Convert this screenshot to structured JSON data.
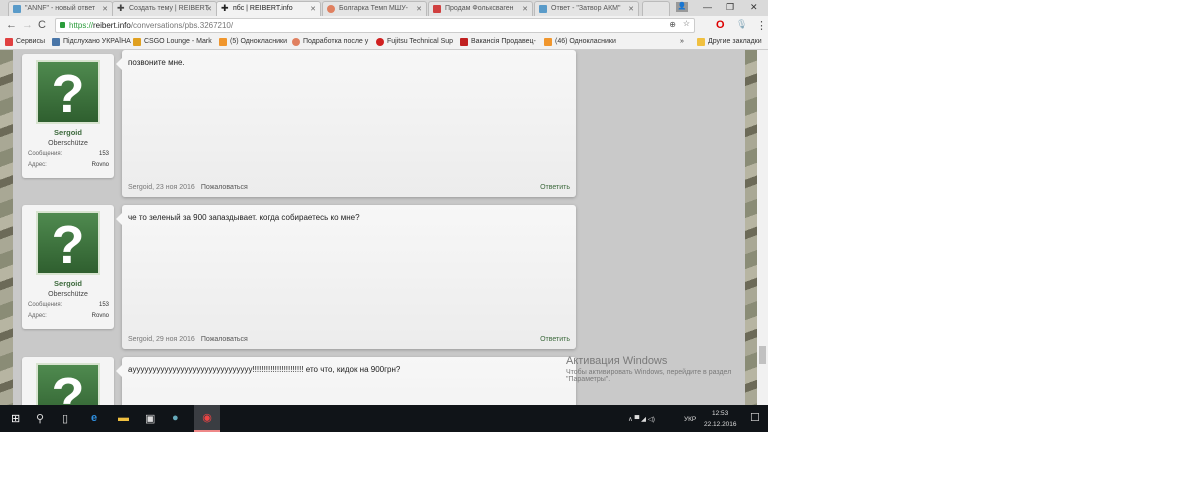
{
  "tabs": [
    {
      "label": "\"ANNF\" - новый ответ",
      "color": "#5a9bc9"
    },
    {
      "label": "Создать тему | REIBERT",
      "color": "#444"
    },
    {
      "label": "пбс | REIBERT.info",
      "color": "#444",
      "active": true
    },
    {
      "label": "Болгарка Темп МШУ-",
      "color": "#e08060"
    },
    {
      "label": "Продам Фольксваген",
      "color": "#d04040"
    },
    {
      "label": "Ответ - \"Затвор АКМ\"",
      "color": "#5a9bc9"
    }
  ],
  "address": {
    "scheme": "https://",
    "host": "reibert.info",
    "path": "/conversations/pbs.3267210/"
  },
  "bookmarks": [
    {
      "label": "Сервисы",
      "color": "#e04040"
    },
    {
      "label": "Підслухано УКРАЇНА",
      "color": "#4a76a8"
    },
    {
      "label": "CSGO Lounge - Mark",
      "color": "#e0a020"
    },
    {
      "label": "(5) Однокласники",
      "color": "#f0962d"
    },
    {
      "label": "Подработка после у",
      "color": "#e08060"
    },
    {
      "label": "Fujitsu Technical Sup",
      "color": "#d02020"
    },
    {
      "label": "Вакансія Продавец-",
      "color": "#c02020"
    },
    {
      "label": "(46) Однокласники",
      "color": "#f0962d"
    }
  ],
  "other_bookmarks": "Другие закладки",
  "posts": [
    {
      "user": "Sergoid",
      "rank": "Oberschütze",
      "messages_label": "Сообщения:",
      "messages": "153",
      "address_label": "Адрес:",
      "address": "Rovno",
      "text": "позвоните мне.",
      "author": "Sergoid",
      "date": "23 ноя 2016",
      "report": "Пожаловаться",
      "reply": "Ответить"
    },
    {
      "user": "Sergoid",
      "rank": "Oberschütze",
      "messages_label": "Сообщения:",
      "messages": "153",
      "address_label": "Адрес:",
      "address": "Rovno",
      "text": "че то зеленый за 900 запаздывает. когда собираетесь ко мне?",
      "author": "Sergoid",
      "date": "29 ноя 2016",
      "report": "Пожаловаться",
      "reply": "Ответить"
    },
    {
      "text": "ayyyyyyyyyyyyyyyyyyyyyyyyyyyyyy!!!!!!!!!!!!!!!!!!!!!!! ето что, кидок на 900грн?"
    }
  ],
  "watermark": {
    "title": "Активация Windows",
    "text": "Чтобы активировать Windows, перейдите в раздел \"Параметры\"."
  },
  "tray": {
    "lang": "УКР",
    "time": "12:53",
    "date": "22.12.2016"
  }
}
